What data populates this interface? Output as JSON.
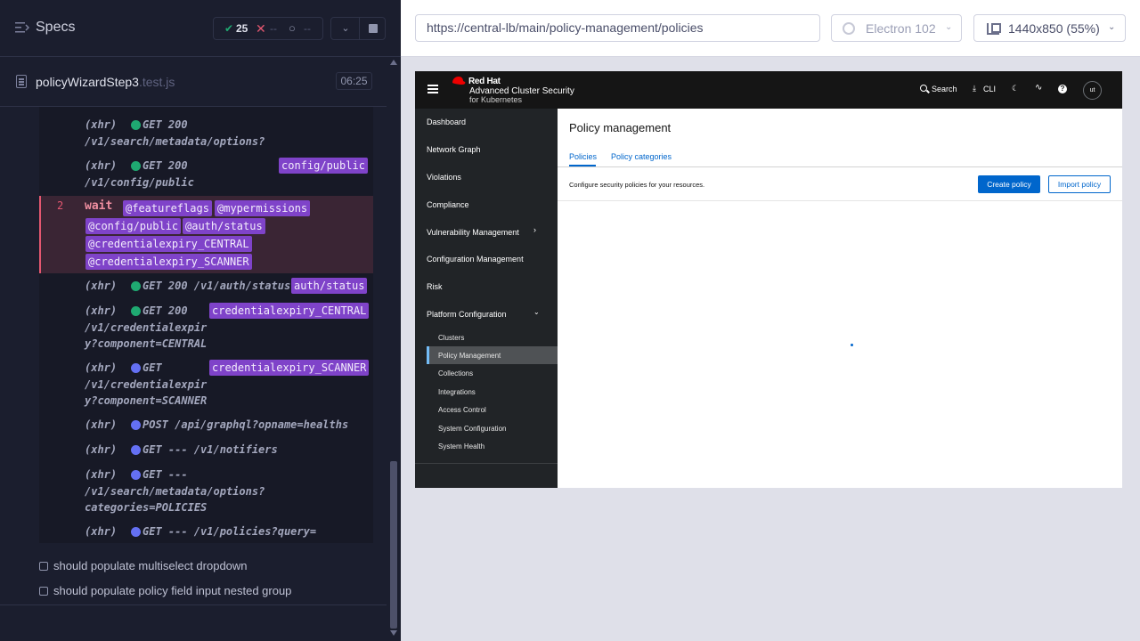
{
  "runner": {
    "header": {
      "title": "Specs",
      "passed": "25",
      "failed": "--",
      "pending": "--"
    },
    "spec": {
      "name": "policyWizardStep3",
      "ext": ".test.js",
      "duration": "06:25"
    },
    "log": {
      "xhr_label": "(xhr)",
      "wait_number": "2",
      "wait_keyword": "wait",
      "commands": [
        {
          "line1": "GET 200",
          "line2": "/v1/search/metadata/options?",
          "alias": ""
        },
        {
          "line1": "GET 200",
          "line2": "/v1/config/public",
          "alias": "config/public"
        },
        {
          "line1": "GET 200 /v1/auth/status",
          "alias": "auth/status"
        },
        {
          "line1": "GET 200",
          "line2": "/v1/credentialexpir",
          "line3": "y?component=CENTRAL",
          "alias": "credentialexpiry_CENTRAL"
        },
        {
          "line1": "GET",
          "line2": "/v1/credentialexpir",
          "line3": "y?component=SCANNER",
          "alias": "credentialexpiry_SCANNER"
        },
        {
          "line1": "POST /api/graphql?opname=healths"
        },
        {
          "line1": "GET --- /v1/notifiers"
        },
        {
          "line1": "GET ---",
          "line2": "/v1/search/metadata/options?",
          "line3": "categories=POLICIES"
        },
        {
          "line1": "GET --- /v1/policies?query="
        }
      ],
      "wait_aliases": [
        "@featureflags",
        "@mypermissions",
        "@config/public",
        "@auth/status",
        "@credentialexpiry_CENTRAL",
        "@credentialexpiry_SCANNER"
      ]
    },
    "tests": [
      "should populate multiselect dropdown",
      "should populate policy field input nested group"
    ]
  },
  "preview": {
    "url": "https://central-lb/main/policy-management/policies",
    "browser": "Electron 102",
    "viewport": "1440x850",
    "scale": "(55%)"
  },
  "app": {
    "brand": {
      "top": "Red Hat",
      "mid": "Advanced Cluster Security",
      "bot": "for Kubernetes"
    },
    "masthead": {
      "search": "Search",
      "cli": "CLI",
      "avatar": "ut"
    },
    "nav": {
      "items": [
        "Dashboard",
        "Network Graph",
        "Violations",
        "Compliance",
        "Vulnerability Management",
        "Configuration Management",
        "Risk",
        "Platform Configuration"
      ],
      "sub_items": [
        "Clusters",
        "Policy Management",
        "Collections",
        "Integrations",
        "Access Control",
        "System Configuration",
        "System Health"
      ]
    },
    "main": {
      "title": "Policy management",
      "tabs": [
        "Policies",
        "Policy categories"
      ],
      "description": "Configure security policies for your resources.",
      "create_button": "Create policy",
      "import_button": "Import policy"
    }
  },
  "colors": {
    "runner_bg": "#1b1e2e",
    "alias_purple": "#7f43c9",
    "pass_green": "#1fa971",
    "fail_red": "#e45770",
    "pending_blue": "#6470f3",
    "acs_blue": "#0066cc"
  }
}
